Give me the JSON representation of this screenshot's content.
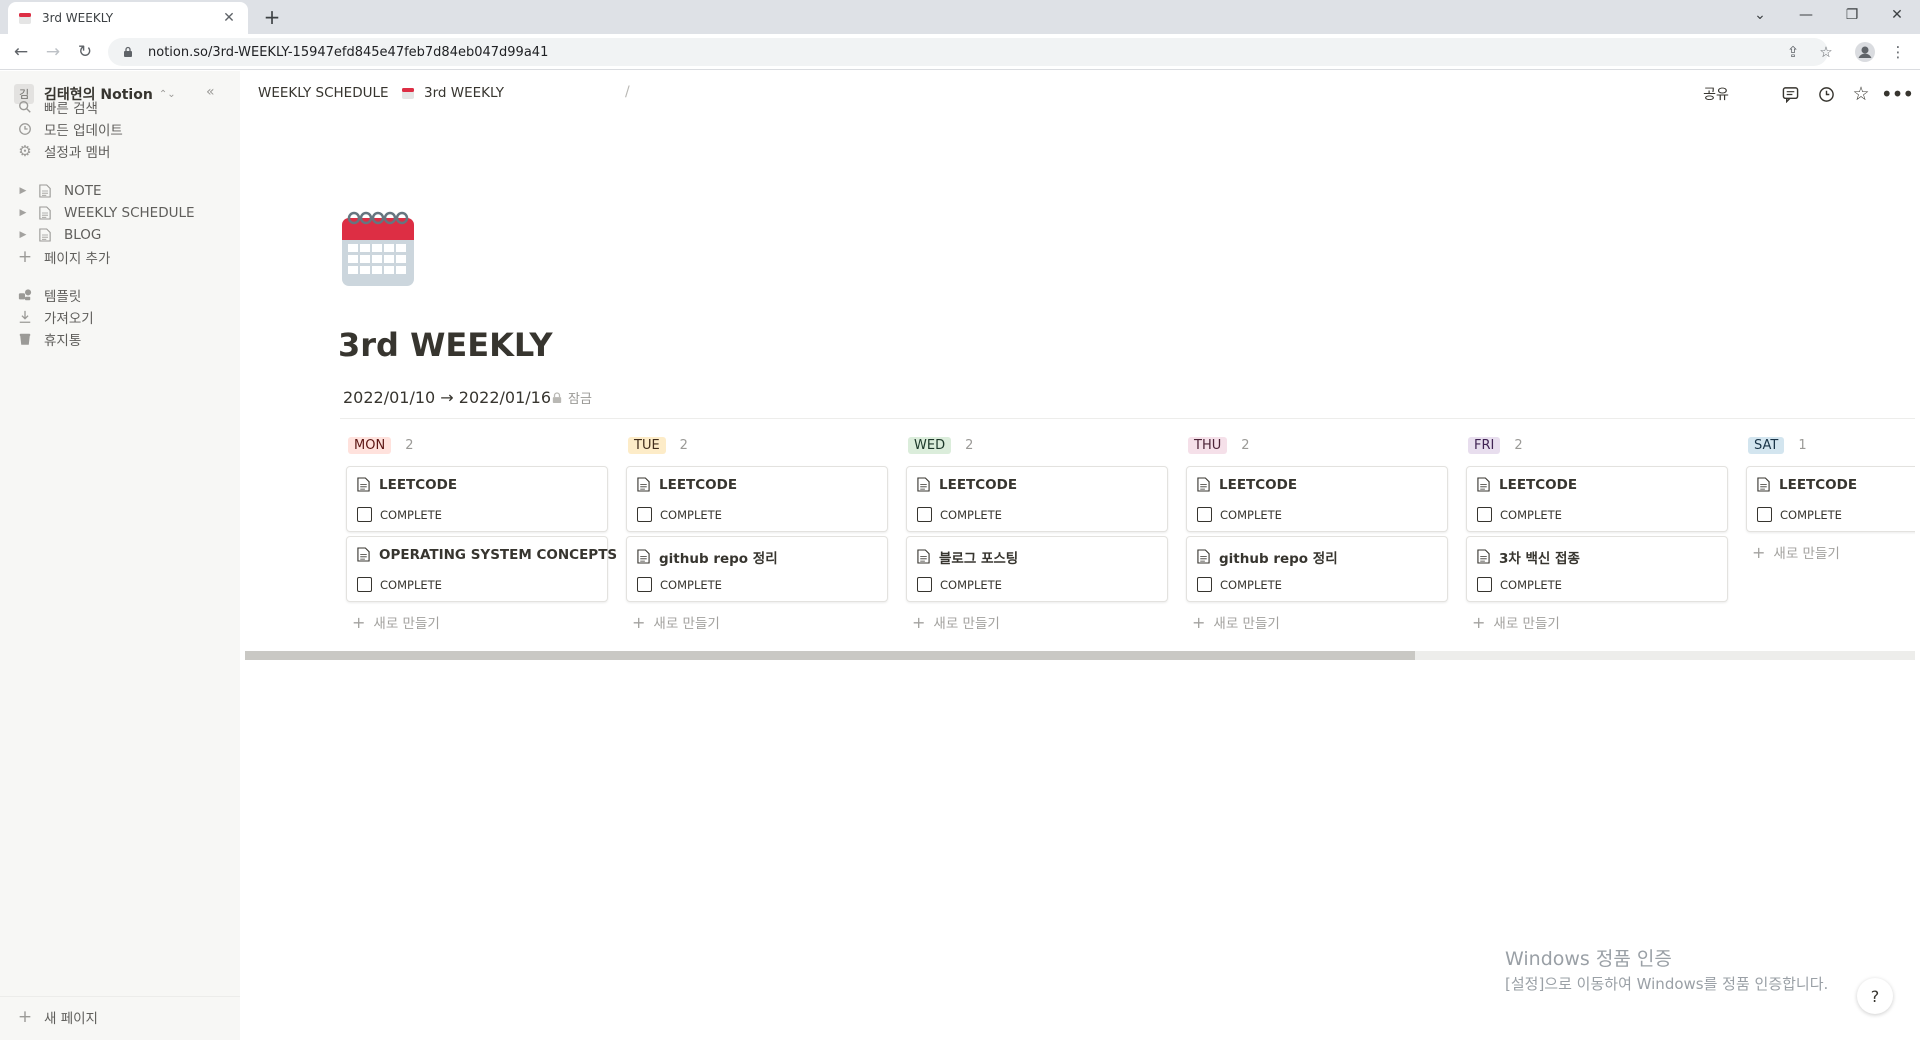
{
  "browser": {
    "tab_title": "3rd WEEKLY",
    "url": "notion.so/3rd-WEEKLY-15947efd845e47feb7d84eb047d99a41"
  },
  "sidebar": {
    "workspace_avatar": "김",
    "workspace_name": "김태현의 Notion",
    "menu": [
      {
        "label": "빠른 검색",
        "icon": "search-icon"
      },
      {
        "label": "모든 업데이트",
        "icon": "clock-icon"
      },
      {
        "label": "설정과 멤버",
        "icon": "gear-icon"
      }
    ],
    "pages": [
      {
        "label": "NOTE"
      },
      {
        "label": "WEEKLY SCHEDULE"
      },
      {
        "label": "BLOG"
      }
    ],
    "add_page": "페이지 추가",
    "tools": [
      {
        "label": "템플릿",
        "icon": "template-icon"
      },
      {
        "label": "가져오기",
        "icon": "download-icon"
      },
      {
        "label": "휴지통",
        "icon": "trash-icon"
      }
    ],
    "new_page": "새 페이지"
  },
  "topbar": {
    "breadcrumb_parent": "WEEKLY SCHEDULE",
    "breadcrumb_current": "3rd WEEKLY",
    "share": "공유"
  },
  "page": {
    "title": "3rd WEEKLY",
    "date_range": "2022/01/10 → 2022/01/16",
    "lock_label": "잠금"
  },
  "board": {
    "new_label": "새로 만들기",
    "check_label": "COMPLETE",
    "columns": [
      {
        "name": "MON",
        "count": "2",
        "bg": "#ffe2dd",
        "fg": "#5d1715",
        "cards": [
          {
            "title": "LEETCODE"
          },
          {
            "title": "OPERATING SYSTEM CONCEPTS"
          }
        ]
      },
      {
        "name": "TUE",
        "count": "2",
        "bg": "#fdecc8",
        "fg": "#402c1b",
        "cards": [
          {
            "title": "LEETCODE"
          },
          {
            "title": "github repo 정리"
          }
        ]
      },
      {
        "name": "WED",
        "count": "2",
        "bg": "#dbeddb",
        "fg": "#1c3829",
        "cards": [
          {
            "title": "LEETCODE"
          },
          {
            "title": "블로그 포스팅"
          }
        ]
      },
      {
        "name": "THU",
        "count": "2",
        "bg": "#f5e0e9",
        "fg": "#4c2337",
        "cards": [
          {
            "title": "LEETCODE"
          },
          {
            "title": "github repo 정리"
          }
        ]
      },
      {
        "name": "FRI",
        "count": "2",
        "bg": "#e8deee",
        "fg": "#412454",
        "cards": [
          {
            "title": "LEETCODE"
          },
          {
            "title": "3차 백신 접종"
          }
        ]
      },
      {
        "name": "SAT",
        "count": "1",
        "bg": "#d3e5ef",
        "fg": "#183347",
        "cards": [
          {
            "title": "LEETCODE"
          }
        ]
      }
    ]
  },
  "watermark": {
    "title": "Windows 정품 인증",
    "subtitle": "[설정]으로 이동하여 Windows를 정품 인증합니다."
  },
  "help": "?"
}
